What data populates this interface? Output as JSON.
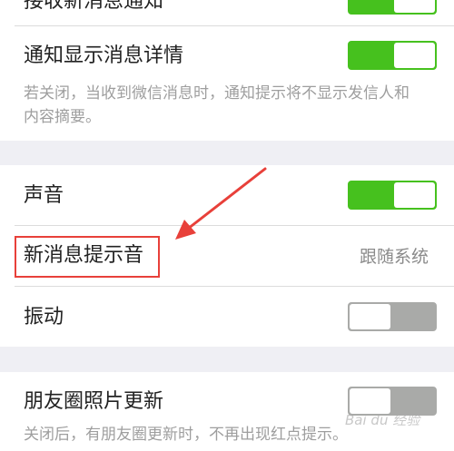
{
  "section1": {
    "row_receive": {
      "label": "接收新消息通知",
      "toggle": "on"
    },
    "row_detail": {
      "label": "通知显示消息详情",
      "toggle": "on",
      "description": "若关闭，当收到微信消息时，通知提示将不显示发信人和内容摘要。"
    }
  },
  "section2": {
    "row_sound": {
      "label": "声音",
      "toggle": "on"
    },
    "row_tone": {
      "label": "新消息提示音",
      "value": "跟随系统"
    },
    "row_vibrate": {
      "label": "振动",
      "toggle": "off"
    }
  },
  "section3": {
    "row_moments": {
      "label": "朋友圈照片更新",
      "toggle": "off",
      "description": "关闭后，有朋友圈更新时，不再出现红点提示。"
    }
  },
  "watermark": "Bai du 经验",
  "colors": {
    "toggle_on": "#46c11e",
    "toggle_off": "#a9aaa8",
    "highlight": "#e8403a",
    "page_bg": "#efeff4"
  }
}
